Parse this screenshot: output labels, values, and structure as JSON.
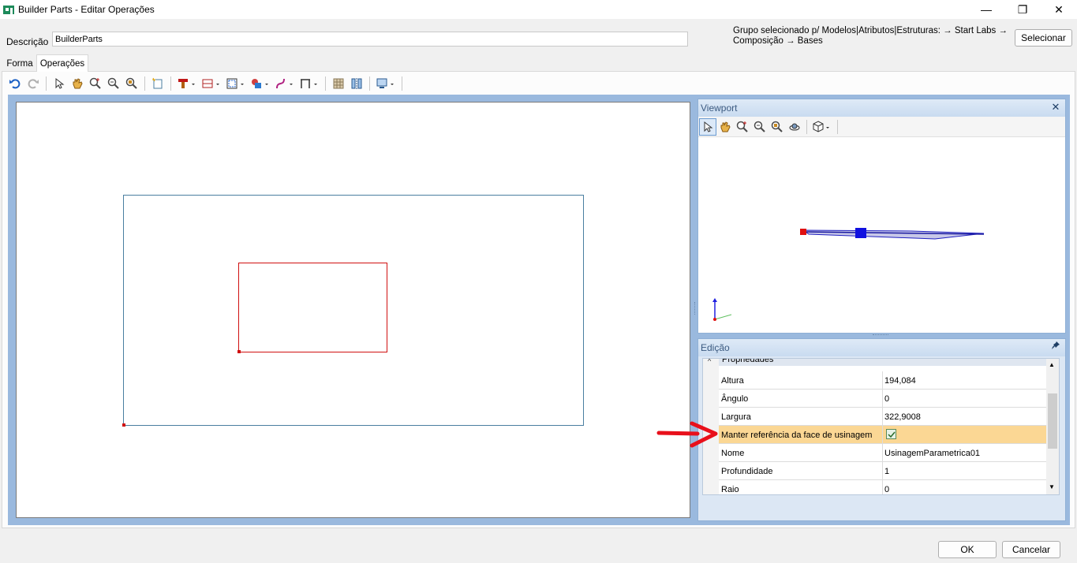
{
  "window": {
    "title": "Builder Parts - Editar Operações",
    "minimize_glyph": "—",
    "maximize_glyph": "❐",
    "close_glyph": "✕"
  },
  "header": {
    "description_label": "Descrição",
    "description_value": "BuilderParts",
    "group_text": "Grupo selecionado p/ Modelos|Atributos|Estruturas: → Start Labs → Composição → Bases",
    "select_button": "Selecionar"
  },
  "tabs": [
    {
      "label": "Forma",
      "active": false
    },
    {
      "label": "Operações",
      "active": true
    }
  ],
  "viewport": {
    "title": "Viewport",
    "close_glyph": "✕"
  },
  "edicao": {
    "title": "Edição",
    "section": "Propriedades",
    "properties": [
      {
        "name": "Altura",
        "value": "194,084"
      },
      {
        "name": "Ângulo",
        "value": "0"
      },
      {
        "name": "Largura",
        "value": "322,9008"
      },
      {
        "name": "Manter referência da face de usinagem",
        "value": "",
        "checked": true
      },
      {
        "name": "Nome",
        "value": "UsinagemParametrica01"
      },
      {
        "name": "Profundidade",
        "value": "1"
      },
      {
        "name": "Raio",
        "value": "0"
      }
    ]
  },
  "footer": {
    "ok": "OK",
    "cancel": "Cancelar"
  },
  "colors": {
    "accent": "#9ab9de",
    "selection": "#fbd794",
    "shape_outline": "#4a7ea0",
    "operation_outline": "#d01010",
    "annotation_arrow": "#e8101b"
  }
}
